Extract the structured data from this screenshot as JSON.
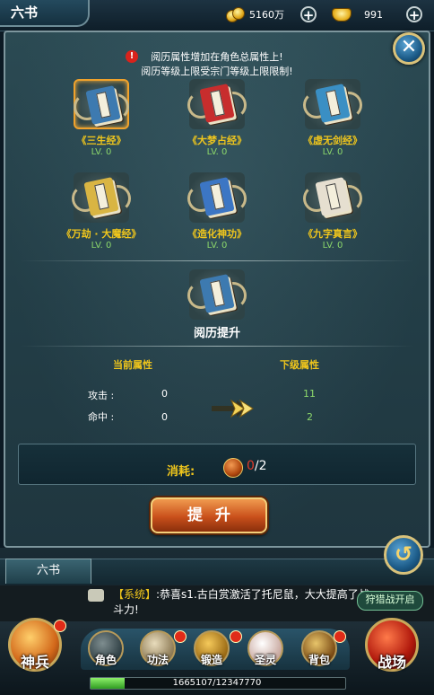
{
  "header": {
    "title": "六书",
    "coins": "5160万",
    "ingots": "991"
  },
  "notice": {
    "line1": "阅历属性增加在角色总属性上!",
    "line2": "阅历等级上限受宗门等级上限限制!"
  },
  "books": [
    {
      "name": "《三生经》",
      "level": "LV. 0",
      "color": "#3d7ab0",
      "selected": true
    },
    {
      "name": "《大梦占经》",
      "level": "LV. 0",
      "color": "#c72d2d"
    },
    {
      "name": "《虚无剑经》",
      "level": "LV. 0",
      "color": "#3a8fc4"
    },
    {
      "name": "《万劫 · 大魔经》",
      "level": "LV. 0",
      "color": "#d9b543"
    },
    {
      "name": "《造化神功》",
      "level": "LV. 0",
      "color": "#3c76c4"
    },
    {
      "name": "《九字真言》",
      "level": "LV. 0",
      "color": "#e6dfd0"
    }
  ],
  "upgrade": {
    "title": "阅历提升",
    "current_header": "当前属性",
    "next_header": "下级属性",
    "attrs": [
      {
        "label": "攻击 :",
        "current": "0",
        "next": "11"
      },
      {
        "label": "命中 :",
        "current": "0",
        "next": "2"
      }
    ],
    "cost_label": "消耗:",
    "cost_have": "0",
    "cost_need": "/2",
    "cost_have_fraction": 0,
    "button": "提升"
  },
  "bottom": {
    "tab": "六书",
    "chat_tag": "【系统】",
    "chat_text": ":恭喜s1.古白赏激活了托尼鼠，大大提高了战斗力!",
    "event": "狩猎战开启",
    "nav": {
      "left_big": "神兵",
      "items": [
        "角色",
        "功法",
        "锻造",
        "圣灵",
        "背包"
      ],
      "right_big": "战场"
    },
    "exp": "1665107/12347770",
    "exp_fraction": 0.135
  },
  "colors": {
    "gold_text": "#f0c61c",
    "green_text": "#8bd66b",
    "red_text": "#e23b2a"
  },
  "icons": {
    "close": "close-icon",
    "return": "return-icon",
    "arrow": "double-arrow-icon",
    "warn": "warning-icon"
  }
}
